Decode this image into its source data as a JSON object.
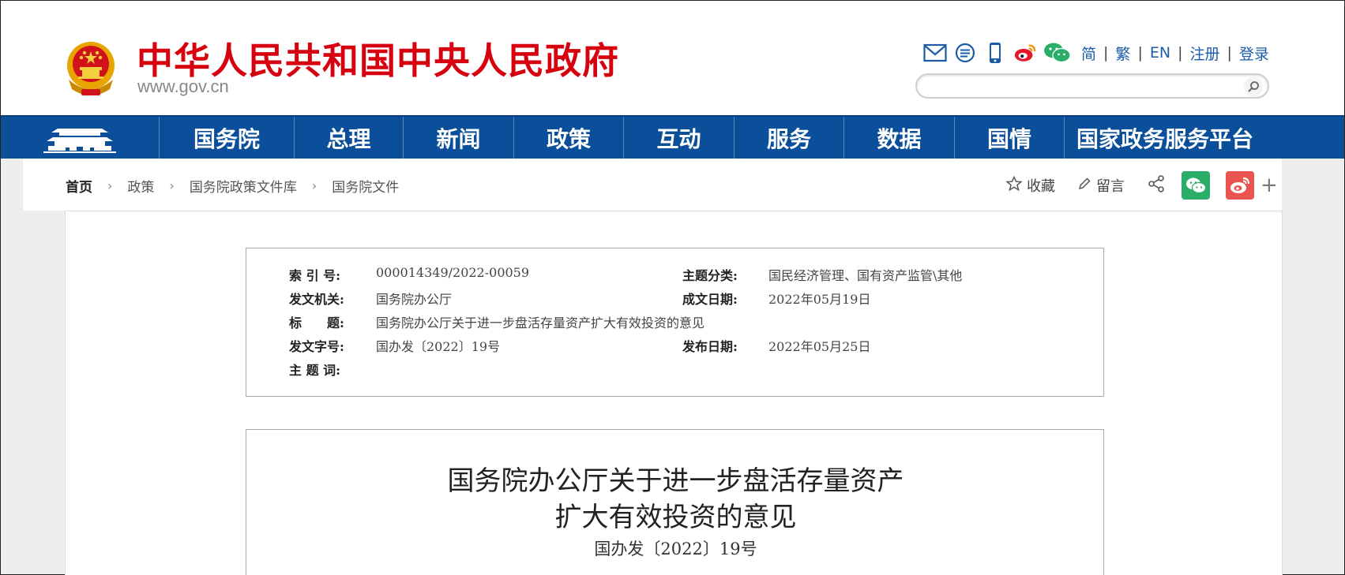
{
  "header": {
    "site_title": "中华人民共和国中央人民政府",
    "site_url": "www.gov.cn",
    "lang_links": [
      "简",
      "繁",
      "EN",
      "注册",
      "登录"
    ],
    "search_placeholder": "",
    "icons": [
      "mail-icon",
      "message-icon",
      "mobile-icon",
      "weibo-icon",
      "wechat-icon",
      "search-icon"
    ]
  },
  "nav": {
    "items": [
      "国务院",
      "总理",
      "新闻",
      "政策",
      "互动",
      "服务",
      "数据",
      "国情",
      "国家政务服务平台"
    ]
  },
  "breadcrumb": {
    "items": [
      "首页",
      "政策",
      "国务院政策文件库",
      "国务院文件"
    ]
  },
  "share": {
    "favorite_label": "收藏",
    "comment_label": "留言",
    "more_label": "+"
  },
  "meta": {
    "index_label": "索 引 号:",
    "index_value": "000014349/2022-00059",
    "category_label": "主题分类:",
    "category_value": "国民经济管理、国有资产监管\\其他",
    "issuer_label": "发文机关:",
    "issuer_value": "国务院办公厅",
    "written_date_label": "成文日期:",
    "written_date_value": "2022年05月19日",
    "title_label": "标　　题:",
    "title_value": "国务院办公厅关于进一步盘活存量资产扩大有效投资的意见",
    "doc_number_label": "发文字号:",
    "doc_number_value": "国办发〔2022〕19号",
    "publish_date_label": "发布日期:",
    "publish_date_value": "2022年05月25日",
    "keywords_label": "主 题 词:",
    "keywords_value": ""
  },
  "document": {
    "title_line1": "国务院办公厅关于进一步盘活存量资产",
    "title_line2": "扩大有效投资的意见",
    "number": "国办发〔2022〕19号"
  },
  "colors": {
    "brand_red": "#d7000f",
    "nav_blue": "#0b4f9a",
    "link_blue": "#1a5ca8",
    "wechat_green": "#2aae67",
    "weibo_red": "#e9544f"
  }
}
